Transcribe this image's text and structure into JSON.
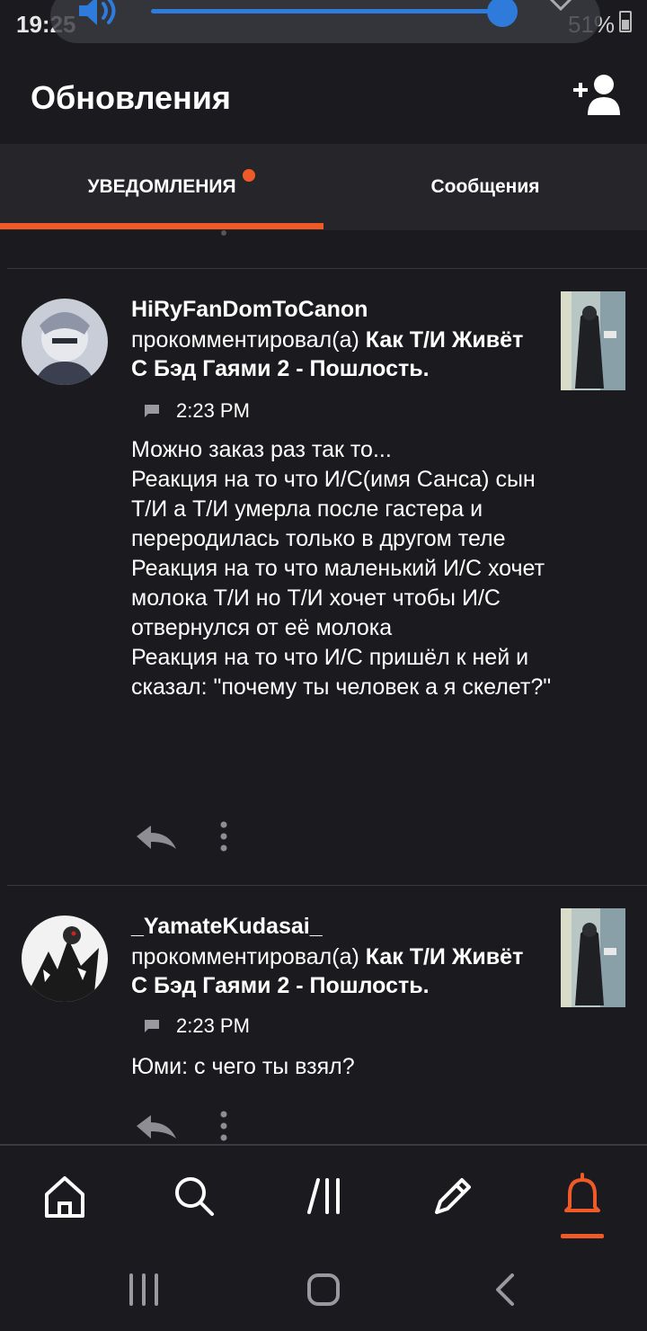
{
  "status_bar": {
    "time": "19:25",
    "battery_text": "51%",
    "volume_level": 0.93
  },
  "header": {
    "title": "Обновления",
    "add_friend_icon": "person-add-icon"
  },
  "tabs": [
    {
      "label": "УВЕДОМЛЕНИЯ",
      "active": true,
      "has_dot": true
    },
    {
      "label": "Сообщения",
      "active": false
    }
  ],
  "notifications": [
    {
      "username": "HiRyFanDomToCanon",
      "action": "прокомментировал(а)",
      "post_title": "Как Т/И Живёт С Бэд Гаями 2 - Пошлость.",
      "time": "2:23 PM",
      "comment": "Можно заказ раз так то...\nРеакция на то что И/С(имя Санса) сын Т/И а Т/И умерла после гастера и переродилась только в другом теле\nРеакция на то что маленький И/С хочет молока Т/И но Т/И хочет чтобы И/С отвернулся от её молока\nРеакция на то что И/С пришёл к ней и сказал: \"почему ты человек а я скелет?\""
    },
    {
      "username": "_YamateKudasai_",
      "action": "прокомментировал(а)",
      "post_title": "Как Т/И Живёт С Бэд Гаями 2 - Пошлость.",
      "time": "2:23 PM",
      "comment": "Юми: с чего ты взял?"
    }
  ],
  "bottom_nav": [
    {
      "icon": "home-icon",
      "active": false
    },
    {
      "icon": "search-icon",
      "active": false
    },
    {
      "icon": "library-icon",
      "active": false
    },
    {
      "icon": "pencil-icon",
      "active": false
    },
    {
      "icon": "bell-icon",
      "active": true
    }
  ],
  "colors": {
    "accent": "#f05a28",
    "background": "#1b1a1e",
    "tabbar": "#26252a",
    "volume": "#2e7bdc"
  }
}
